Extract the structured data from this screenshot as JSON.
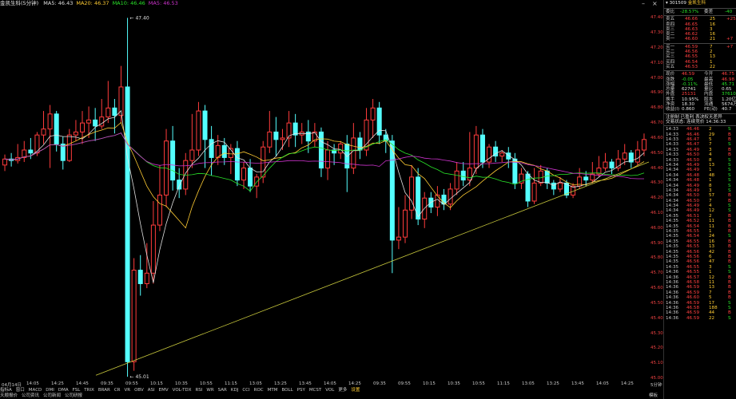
{
  "header": {
    "title": "金凯生科(5分钟)",
    "ma_labels": [
      {
        "text": "MA5: 46.43",
        "color": "#e0e0e0"
      },
      {
        "text": "MA20: 46.37",
        "color": "#ffcc33"
      },
      {
        "text": "MA10: 46.46",
        "color": "#29e329"
      },
      {
        "text": "MA5: 46.53",
        "color": "#cc33cc"
      }
    ]
  },
  "axis": {
    "y_ticks": [
      "47.40",
      "47.30",
      "47.20",
      "47.10",
      "47.00",
      "46.90",
      "46.80",
      "46.70",
      "46.60",
      "46.50",
      "46.40",
      "46.30",
      "46.20",
      "46.10",
      "46.00",
      "45.90",
      "45.80",
      "45.70",
      "45.60",
      "45.50",
      "45.40",
      "45.30",
      "45.20",
      "45.10",
      "45.00"
    ],
    "x_ticks": [
      "04月14日",
      "14:05",
      "14:25",
      "14:45",
      "09:35",
      "09:55",
      "10:15",
      "10:35",
      "10:55",
      "11:15",
      "13:05",
      "13:25",
      "13:45",
      "14:05",
      "14:25",
      "09:35",
      "09:55",
      "10:15",
      "10:35",
      "10:55",
      "11:15",
      "13:05",
      "13:25",
      "13:45",
      "14:05",
      "14:25"
    ],
    "max_label": "47.40",
    "min_label": "45.01",
    "period_label": "5分钟"
  },
  "indicator_tabs": [
    "指标A",
    "窗口",
    "MACD",
    "DMI",
    "DMA",
    "FSL",
    "TRIX",
    "BRAR",
    "CR",
    "VR",
    "OBV",
    "ASI",
    "EMV",
    "VOL-TDX",
    "RSI",
    "WR",
    "SAR",
    "KDJ",
    "CCI",
    "ROC",
    "MTM",
    "BOLL",
    "PSY",
    "MCST",
    "VOL",
    "更多",
    "设置"
  ],
  "bottom_tabs": [
    "天顺报价",
    "公司资讯",
    "公司新闻",
    "公司研报"
  ],
  "bottom_right": "模板",
  "panel": {
    "code": "301509",
    "name": "金凯生科",
    "weibi": {
      "label": "委比",
      "value": "-28.57%",
      "label2": "委差",
      "value2": "-40"
    },
    "sells": [
      {
        "label": "卖五",
        "price": "46.66",
        "vol": "25",
        "chg": "+25"
      },
      {
        "label": "卖四",
        "price": "46.65",
        "vol": "16",
        "chg": ""
      },
      {
        "label": "卖三",
        "price": "46.63",
        "vol": "3",
        "chg": ""
      },
      {
        "label": "卖二",
        "price": "46.62",
        "vol": "16",
        "chg": ""
      },
      {
        "label": "卖一",
        "price": "46.60",
        "vol": "21",
        "chg": "+7"
      }
    ],
    "buys": [
      {
        "label": "买一",
        "price": "46.59",
        "vol": "7",
        "chg": "+7"
      },
      {
        "label": "买二",
        "price": "46.56",
        "vol": "2",
        "chg": ""
      },
      {
        "label": "买三",
        "price": "46.55",
        "vol": "13",
        "chg": ""
      },
      {
        "label": "买四",
        "price": "46.54",
        "vol": "1",
        "chg": ""
      },
      {
        "label": "买五",
        "price": "46.53",
        "vol": "22",
        "chg": ""
      }
    ],
    "stats": [
      {
        "l1": "现价",
        "v1": "46.59",
        "l2": "今开",
        "v2": "46.75"
      },
      {
        "l1": "涨跌",
        "v1": "-0.05",
        "l2": "最高",
        "v2": "46.98"
      },
      {
        "l1": "涨幅",
        "v1": "-0.11%",
        "l2": "最低",
        "v2": "45.71"
      },
      {
        "l1": "总量",
        "v1": "62741",
        "l2": "量比",
        "v2": "0.65"
      },
      {
        "l1": "外盘",
        "v1": "25131",
        "l2": "内盘",
        "v2": "37610"
      },
      {
        "l1": "换手",
        "v1": "10.95%",
        "l2": "股本",
        "v2": "1.20亿"
      },
      {
        "l1": "净资",
        "v1": "18.30",
        "l2": "流通",
        "v2": "5674万"
      },
      {
        "l1": "收益(I)",
        "v1": "0.860",
        "l2": "PE(动)",
        "v2": "40.7"
      }
    ],
    "notes": [
      "注册制 已盈利 表决权无差异",
      "交易状态: 连续竞价 14:36:33"
    ],
    "ticks": [
      {
        "t": "14:33",
        "p": "46.46",
        "v": "2",
        "d": "S"
      },
      {
        "t": "14:33",
        "p": "46.46",
        "v": "29",
        "d": "B"
      },
      {
        "t": "14:33",
        "p": "46.47",
        "v": "5",
        "d": "B"
      },
      {
        "t": "14:33",
        "p": "46.47",
        "v": "7",
        "d": "S"
      },
      {
        "t": "14:33",
        "p": "46.49",
        "v": "3",
        "d": "B"
      },
      {
        "t": "14:33",
        "p": "46.50",
        "v": "4",
        "d": "B"
      },
      {
        "t": "14:33",
        "p": "46.50",
        "v": "8",
        "d": "S"
      },
      {
        "t": "14:34",
        "p": "46.49",
        "v": "13",
        "d": "S"
      },
      {
        "t": "14:34",
        "p": "46.49",
        "v": "1",
        "d": "S"
      },
      {
        "t": "14:34",
        "p": "46.48",
        "v": "48",
        "d": "S"
      },
      {
        "t": "14:34",
        "p": "46.48",
        "v": "1",
        "d": "S"
      },
      {
        "t": "14:34",
        "p": "46.49",
        "v": "8",
        "d": "S"
      },
      {
        "t": "14:34",
        "p": "46.49",
        "v": "3",
        "d": "S"
      },
      {
        "t": "14:34",
        "p": "46.50",
        "v": "57",
        "d": "B"
      },
      {
        "t": "14:34",
        "p": "46.50",
        "v": "7",
        "d": "B"
      },
      {
        "t": "14:34",
        "p": "46.49",
        "v": "4",
        "d": "S"
      },
      {
        "t": "14:34",
        "p": "46.49",
        "v": "12",
        "d": "S"
      },
      {
        "t": "14:35",
        "p": "46.51",
        "v": "2",
        "d": "B"
      },
      {
        "t": "14:35",
        "p": "46.52",
        "v": "11",
        "d": "B"
      },
      {
        "t": "14:35",
        "p": "46.54",
        "v": "11",
        "d": "B"
      },
      {
        "t": "14:35",
        "p": "46.55",
        "v": "1",
        "d": "B"
      },
      {
        "t": "14:35",
        "p": "46.54",
        "v": "24",
        "d": "S"
      },
      {
        "t": "14:35",
        "p": "46.55",
        "v": "16",
        "d": "B"
      },
      {
        "t": "14:35",
        "p": "46.55",
        "v": "13",
        "d": "B"
      },
      {
        "t": "14:35",
        "p": "46.56",
        "v": "42",
        "d": "B"
      },
      {
        "t": "14:35",
        "p": "46.56",
        "v": "6",
        "d": "B"
      },
      {
        "t": "14:35",
        "p": "46.56",
        "v": "47",
        "d": "B"
      },
      {
        "t": "14:35",
        "p": "46.55",
        "v": "3",
        "d": "S"
      },
      {
        "t": "14:36",
        "p": "46.55",
        "v": "1",
        "d": "S"
      },
      {
        "t": "14:36",
        "p": "46.57",
        "v": "12",
        "d": "B"
      },
      {
        "t": "14:36",
        "p": "46.58",
        "v": "11",
        "d": "B"
      },
      {
        "t": "14:36",
        "p": "46.59",
        "v": "13",
        "d": "B"
      },
      {
        "t": "14:36",
        "p": "46.59",
        "v": "7",
        "d": "B"
      },
      {
        "t": "14:36",
        "p": "46.60",
        "v": "5",
        "d": "B"
      },
      {
        "t": "14:36",
        "p": "46.59",
        "v": "17",
        "d": "S"
      },
      {
        "t": "14:36",
        "p": "46.58",
        "v": "188",
        "d": "S"
      },
      {
        "t": "14:36",
        "p": "46.59",
        "v": "44",
        "d": "B"
      },
      {
        "t": "14:36",
        "p": "46.59",
        "v": "22",
        "d": "S"
      }
    ]
  },
  "chart_data": {
    "type": "candlestick",
    "title": "金凯生科(5分钟)",
    "ylim": [
      45.0,
      47.45
    ],
    "max_price": 47.4,
    "min_price": 45.01,
    "candles": [
      [
        46.42,
        46.46,
        46.38,
        46.49
      ],
      [
        46.46,
        46.45,
        46.41,
        46.5
      ],
      [
        46.45,
        46.47,
        46.43,
        46.56
      ],
      [
        46.47,
        46.52,
        46.44,
        46.58
      ],
      [
        46.52,
        46.5,
        46.46,
        46.6
      ],
      [
        46.5,
        46.62,
        46.48,
        46.64
      ],
      [
        46.62,
        46.66,
        46.56,
        46.78
      ],
      [
        46.66,
        46.76,
        46.4,
        46.82
      ],
      [
        46.76,
        46.56,
        46.51,
        46.78
      ],
      [
        46.56,
        46.45,
        46.39,
        46.61
      ],
      [
        46.45,
        46.62,
        46.44,
        46.66
      ],
      [
        46.62,
        46.64,
        46.58,
        46.72
      ],
      [
        46.64,
        46.7,
        46.56,
        46.78
      ],
      [
        46.7,
        46.72,
        46.6,
        46.81
      ],
      [
        46.72,
        46.68,
        46.58,
        46.8
      ],
      [
        46.68,
        46.74,
        46.66,
        46.86
      ],
      [
        46.74,
        46.8,
        46.7,
        46.98
      ],
      [
        46.8,
        46.75,
        46.63,
        46.86
      ],
      [
        46.75,
        46.94,
        46.7,
        47.08
      ],
      [
        46.94,
        45.11,
        45.01,
        47.4
      ],
      [
        45.11,
        45.72,
        45.05,
        45.8
      ],
      [
        45.72,
        45.63,
        45.55,
        45.82
      ],
      [
        45.63,
        45.7,
        45.6,
        45.9
      ],
      [
        45.7,
        46.02,
        45.63,
        46.18
      ],
      [
        46.02,
        46.22,
        45.98,
        46.42
      ],
      [
        46.22,
        46.58,
        46.14,
        46.66
      ],
      [
        46.58,
        46.32,
        46.25,
        46.68
      ],
      [
        46.32,
        46.26,
        46.2,
        46.4
      ],
      [
        46.26,
        46.45,
        46.22,
        46.5
      ],
      [
        46.45,
        46.52,
        46.4,
        46.76
      ],
      [
        46.52,
        46.78,
        46.48,
        46.84
      ],
      [
        46.78,
        46.59,
        46.4,
        46.82
      ],
      [
        46.59,
        46.47,
        46.35,
        46.68
      ],
      [
        46.47,
        46.55,
        46.42,
        46.62
      ],
      [
        46.55,
        46.47,
        46.42,
        46.6
      ],
      [
        46.47,
        46.53,
        46.36,
        46.56
      ],
      [
        46.53,
        46.32,
        46.28,
        46.58
      ],
      [
        46.32,
        46.4,
        46.26,
        46.44
      ],
      [
        46.4,
        46.28,
        46.24,
        46.46
      ],
      [
        46.28,
        46.34,
        46.2,
        46.36
      ],
      [
        46.34,
        46.54,
        46.3,
        46.58
      ],
      [
        46.54,
        46.64,
        46.5,
        46.78
      ],
      [
        46.64,
        46.59,
        46.48,
        46.74
      ],
      [
        46.59,
        46.6,
        46.52,
        46.66
      ],
      [
        46.6,
        46.7,
        46.54,
        46.78
      ],
      [
        46.7,
        46.62,
        46.54,
        46.76
      ],
      [
        46.62,
        46.64,
        46.56,
        46.7
      ],
      [
        46.64,
        46.58,
        46.5,
        46.72
      ],
      [
        46.58,
        46.64,
        46.54,
        46.7
      ],
      [
        46.64,
        46.4,
        46.34,
        46.67
      ],
      [
        46.4,
        46.52,
        46.32,
        46.58
      ],
      [
        46.52,
        46.5,
        46.42,
        46.56
      ],
      [
        46.5,
        46.56,
        46.46,
        46.58
      ],
      [
        46.56,
        46.4,
        46.24,
        46.62
      ],
      [
        46.4,
        46.6,
        46.36,
        46.7
      ],
      [
        46.6,
        46.52,
        46.46,
        46.64
      ],
      [
        46.52,
        46.72,
        46.48,
        46.8
      ],
      [
        46.72,
        46.8,
        46.6,
        46.86
      ],
      [
        46.8,
        46.62,
        46.56,
        46.84
      ],
      [
        46.62,
        46.58,
        46.5,
        46.66
      ],
      [
        46.58,
        45.92,
        45.7,
        46.62
      ],
      [
        45.92,
        45.94,
        45.86,
        46.14
      ],
      [
        45.94,
        46.12,
        45.9,
        46.22
      ],
      [
        46.12,
        46.34,
        46.06,
        46.42
      ],
      [
        46.34,
        46.06,
        46.02,
        46.4
      ],
      [
        46.06,
        46.2,
        46.0,
        46.24
      ],
      [
        46.2,
        46.14,
        46.1,
        46.24
      ],
      [
        46.14,
        46.22,
        46.08,
        46.28
      ],
      [
        46.22,
        46.16,
        46.12,
        46.26
      ],
      [
        46.16,
        46.26,
        46.12,
        46.3
      ],
      [
        46.26,
        46.38,
        46.22,
        46.44
      ],
      [
        46.38,
        46.32,
        46.28,
        46.44
      ],
      [
        46.32,
        46.4,
        46.28,
        46.64
      ],
      [
        46.4,
        46.62,
        46.36,
        46.68
      ],
      [
        46.62,
        46.44,
        46.4,
        46.66
      ],
      [
        46.44,
        46.54,
        46.4,
        46.56
      ],
      [
        46.54,
        46.48,
        46.44,
        46.58
      ],
      [
        46.48,
        46.5,
        46.44,
        46.52
      ],
      [
        46.5,
        46.46,
        46.4,
        46.54
      ],
      [
        46.46,
        46.3,
        46.26,
        46.5
      ],
      [
        46.3,
        46.36,
        46.26,
        46.4
      ],
      [
        46.36,
        46.18,
        46.14,
        46.38
      ],
      [
        46.18,
        46.3,
        46.16,
        46.4
      ],
      [
        46.3,
        46.38,
        46.28,
        46.42
      ],
      [
        46.38,
        46.3,
        46.26,
        46.4
      ],
      [
        46.3,
        46.26,
        46.22,
        46.32
      ],
      [
        46.26,
        46.3,
        46.24,
        46.34
      ],
      [
        46.3,
        46.22,
        46.2,
        46.32
      ],
      [
        46.22,
        46.28,
        46.2,
        46.3
      ],
      [
        46.28,
        46.34,
        46.26,
        46.4
      ],
      [
        46.34,
        46.32,
        46.28,
        46.38
      ],
      [
        46.32,
        46.36,
        46.3,
        46.44
      ],
      [
        46.36,
        46.4,
        46.34,
        46.48
      ],
      [
        46.4,
        46.44,
        46.38,
        46.5
      ],
      [
        46.44,
        46.4,
        46.36,
        46.46
      ],
      [
        46.4,
        46.46,
        46.38,
        46.52
      ],
      [
        46.46,
        46.5,
        46.42,
        46.56
      ],
      [
        46.5,
        46.44,
        46.4,
        46.52
      ],
      [
        46.44,
        46.52,
        46.42,
        46.58
      ],
      [
        46.52,
        46.59,
        46.48,
        46.63
      ]
    ]
  }
}
